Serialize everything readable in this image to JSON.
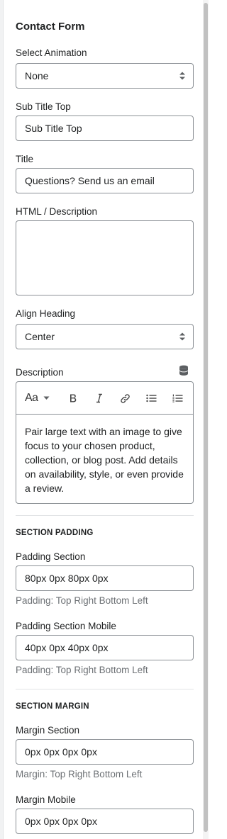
{
  "panel": {
    "title": "Contact Form"
  },
  "fields": {
    "animation": {
      "label": "Select Animation",
      "value": "None"
    },
    "subtitle_top": {
      "label": "Sub Title Top",
      "value": "Sub Title Top"
    },
    "title": {
      "label": "Title",
      "value": "Questions? Send us an email"
    },
    "html_description": {
      "label": "HTML / Description",
      "value": ""
    },
    "align_heading": {
      "label": "Align Heading",
      "value": "Center"
    },
    "description": {
      "label": "Description",
      "font_menu_label": "Aa",
      "body": "Pair large text with an image to give focus to your chosen product, collection, or blog post. Add details on availability, style, or even provide a review."
    }
  },
  "section_padding": {
    "heading": "SECTION PADDING",
    "padding_section": {
      "label": "Padding Section",
      "value": "80px 0px 80px 0px",
      "help": "Padding: Top Right Bottom Left"
    },
    "padding_mobile": {
      "label": "Padding Section Mobile",
      "value": "40px 0px 40px 0px",
      "help": "Padding: Top Right Bottom Left"
    }
  },
  "section_margin": {
    "heading": "SECTION MARGIN",
    "margin_section": {
      "label": "Margin Section",
      "value": "0px 0px 0px 0px",
      "help": "Margin: Top Right Bottom Left"
    },
    "margin_mobile": {
      "label": "Margin Mobile",
      "value": "0px 0px 0px 0px"
    }
  },
  "icons": [
    "select-arrows-icon",
    "dynamic-source-icon",
    "bold-icon",
    "italic-icon",
    "link-icon",
    "bullet-list-icon",
    "numbered-list-icon",
    "chevron-down-icon"
  ],
  "colors": {
    "text": "#202223",
    "subdued": "#6d7175",
    "border": "#8c9196",
    "divider": "#e1e3e5"
  }
}
